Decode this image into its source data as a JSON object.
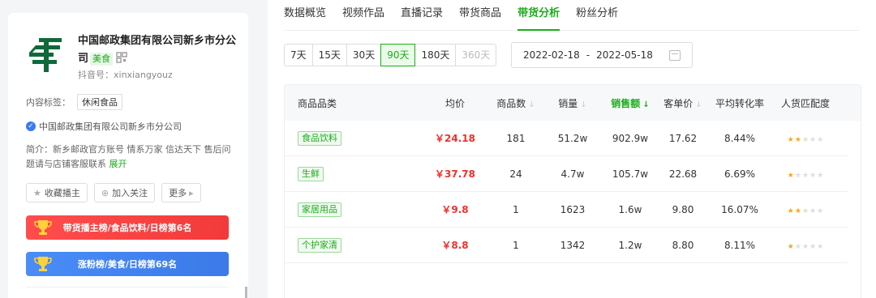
{
  "profile": {
    "name_line": "中国邮政集团有限公司新乡市分公司",
    "food_tag": "美食",
    "douyin_id": "抖音号：xinxiangyouz",
    "content_tag_label": "内容标签：",
    "content_tag": "休闲食品",
    "verified_text": "中国邮政集团有限公司新乡市分公司",
    "intro": "简介：新乡邮政官方账号 情系万家 信达天下 售后问题请与店铺客服联系",
    "expand": "展开",
    "buttons": {
      "collect": "收藏播主",
      "follow": "加入关注",
      "more": "更多"
    },
    "rank_red": "带货播主榜/食品饮料/日榜第6名",
    "rank_blue": "涨粉榜/美食/日榜第69名"
  },
  "tabs": [
    {
      "label": "数据概览",
      "active": false
    },
    {
      "label": "视频作品",
      "active": false
    },
    {
      "label": "直播记录",
      "active": false
    },
    {
      "label": "带货商品",
      "active": false
    },
    {
      "label": "带货分析",
      "active": true
    },
    {
      "label": "粉丝分析",
      "active": false
    }
  ],
  "ranges": [
    {
      "label": "7天",
      "active": false
    },
    {
      "label": "15天",
      "active": false
    },
    {
      "label": "30天",
      "active": false
    },
    {
      "label": "90天",
      "active": true
    },
    {
      "label": "180天",
      "active": false
    },
    {
      "label": "360天",
      "active": false
    }
  ],
  "date_range": {
    "start": "2022-02-18",
    "sep": "-",
    "end": "2022-05-18"
  },
  "table": {
    "headers": [
      "商品品类",
      "均价",
      "商品数",
      "销量",
      "销售额",
      "客单价",
      "平均转化率",
      "人货匹配度"
    ],
    "rows": [
      {
        "category": "食品饮料",
        "price": "￥24.18",
        "count": "181",
        "volume": "51.2w",
        "sales": "902.9w",
        "unit": "17.62",
        "conv": "8.44%",
        "match": 2
      },
      {
        "category": "生鲜",
        "price": "￥37.78",
        "count": "24",
        "volume": "4.7w",
        "sales": "105.7w",
        "unit": "22.68",
        "conv": "6.69%",
        "match": 1
      },
      {
        "category": "家居用品",
        "price": "￥9.8",
        "count": "1",
        "volume": "1623",
        "sales": "1.6w",
        "unit": "9.80",
        "conv": "16.07%",
        "match": 2
      },
      {
        "category": "个护家清",
        "price": "￥8.8",
        "count": "1",
        "volume": "1342",
        "sales": "1.2w",
        "unit": "8.80",
        "conv": "8.11%",
        "match": 1
      }
    ]
  },
  "colors": {
    "accent": "#1aad19",
    "price": "#f0302a",
    "rank_red": "#f23a3a",
    "rank_blue": "#3b7ae8"
  }
}
